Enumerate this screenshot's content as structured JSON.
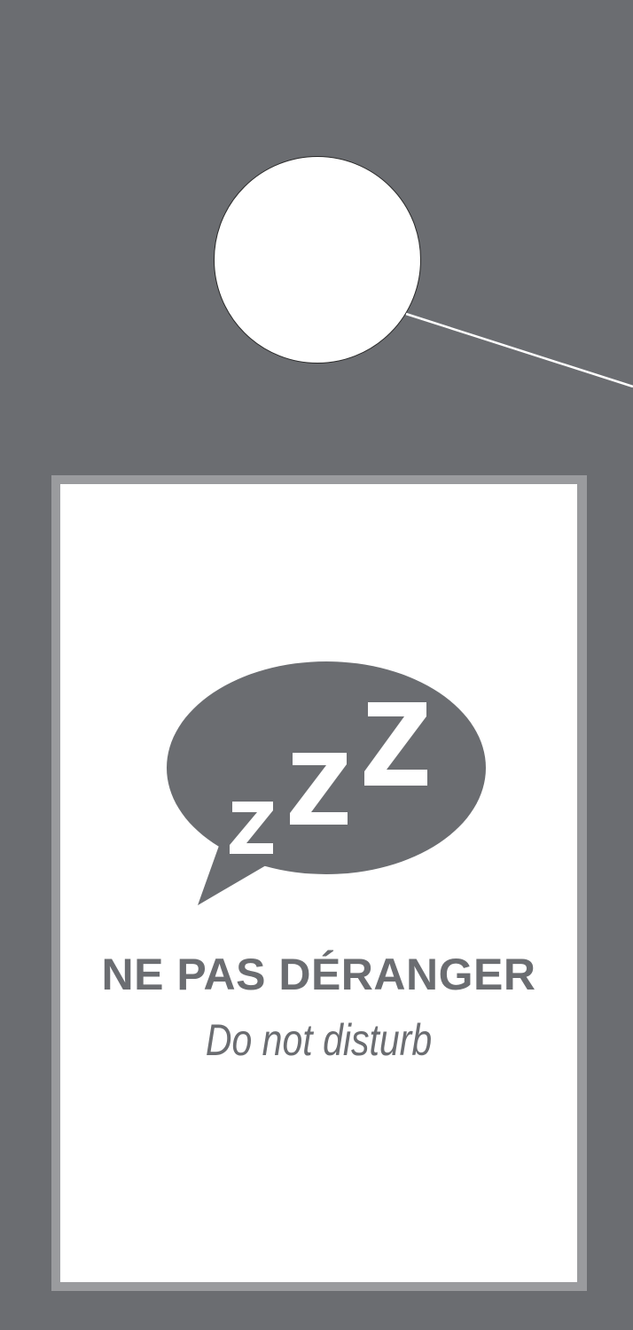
{
  "sign": {
    "title": "NE PAS DÉRANGER",
    "subtitle": "Do not disturb"
  },
  "icon": {
    "name": "sleep-speech-bubble-icon",
    "glyph": "zZZ"
  },
  "colors": {
    "card": "#6b6d71",
    "panel_border": "#9a9b9e",
    "panel": "#ffffff",
    "text": "#6b6d71"
  }
}
